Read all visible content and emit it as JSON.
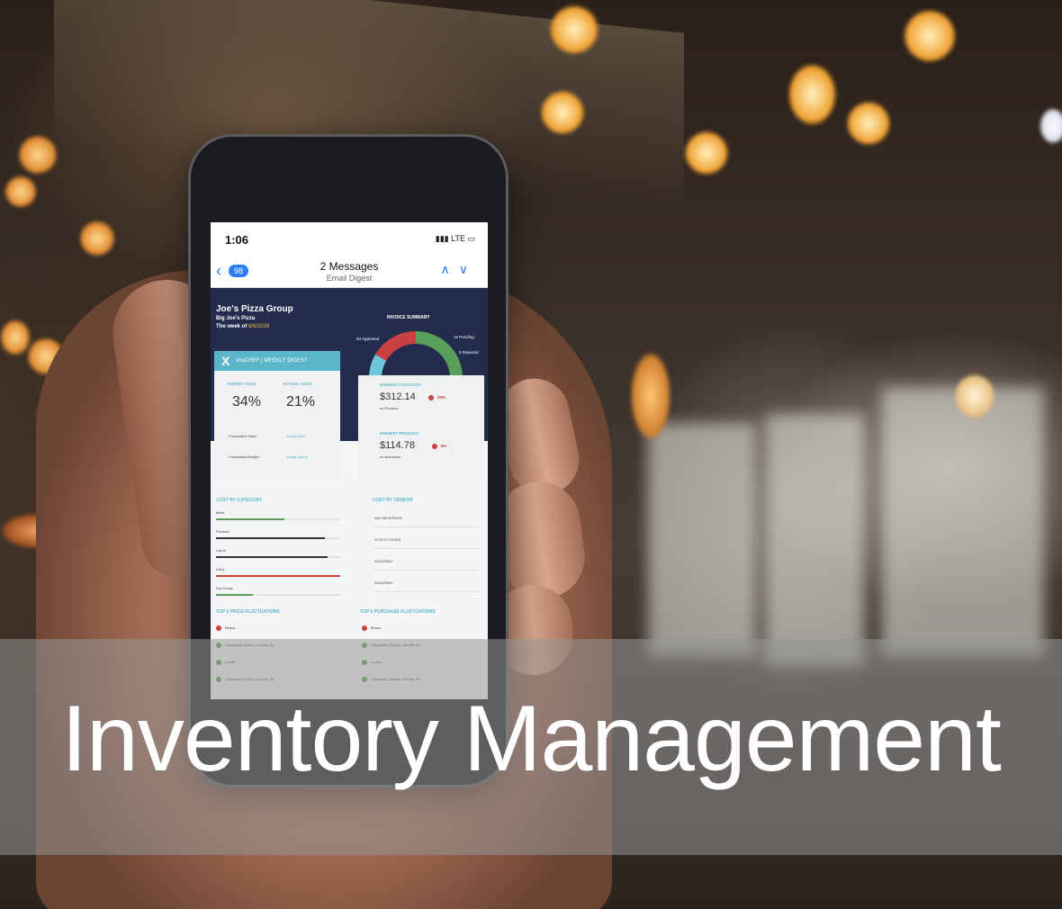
{
  "caption": "Inventory Management",
  "phone": {
    "time": "1:06",
    "signal": "LTE",
    "back_count": "98",
    "nav_title": "2 Messages",
    "nav_subtitle": "Email Digest",
    "email": {
      "group": "Joe's Pizza Group",
      "location": "Big Joe's Pizza",
      "week_label": "The week of",
      "week_date": "8/6/2018",
      "invoice_summary": "INVOICE SUMMARY",
      "approved": "53 Approved",
      "pending": "12 Pending",
      "rejected": "5 Rejected",
      "brand": "xtraCHEF",
      "digest": "WEEKLY DIGEST",
      "target_cogs_label": "TARGET COGS",
      "actual_cogs_label": "ACTUAL COGS",
      "target_cogs": "34%",
      "actual_cogs": "21%",
      "forecasted_sales": "Forecasted Sales",
      "actual_sales": "Actual Sales",
      "forecasted_budget": "Forecasted Budget",
      "actual_spend": "Actual Spend",
      "highest_category_label": "HIGHEST CATEGORY",
      "highest_category_value": "$312.14",
      "highest_category_pct": "20%",
      "highest_category_name": "on Produce",
      "highest_product_label": "HIGHEST PRODUCT",
      "highest_product_value": "$114.78",
      "highest_product_pct": "9%",
      "highest_product_name": "on Avocados",
      "cost_by_category": "COST BY CATEGORY",
      "cost_by_vendor": "COST BY VENDOR",
      "categories": [
        {
          "name": "Meat",
          "fill": 0.55,
          "color": "#5aa05a"
        },
        {
          "name": "Produce",
          "fill": 0.88,
          "color": "#333333"
        },
        {
          "name": "Liquor",
          "fill": 0.9,
          "color": "#333333"
        },
        {
          "name": "Dairy",
          "fill": 1.0,
          "color": "#c94040"
        },
        {
          "name": "Dry Goods",
          "fill": 0.3,
          "color": "#5aa05a"
        }
      ],
      "vendors": [
        "ABV BEVERAGE",
        "SYSCO FOODS",
        "DIGIORNO",
        "DIGIORNO"
      ],
      "price_fluct": "TOP 5 PRICE FLUCTUATIONS",
      "purchase_fluct": "TOP 5 PURCHASE FLUCTUATIONS",
      "price_items": [
        "Beans",
        "Campbells Chicken Noodle So...",
        "Lentils",
        "Campbells Chicken Noodle So..."
      ],
      "purchase_items": [
        "Beans",
        "Campbells Chicken Noodle So...",
        "Lentils",
        "Campbells Chicken Noodle So..."
      ]
    }
  }
}
